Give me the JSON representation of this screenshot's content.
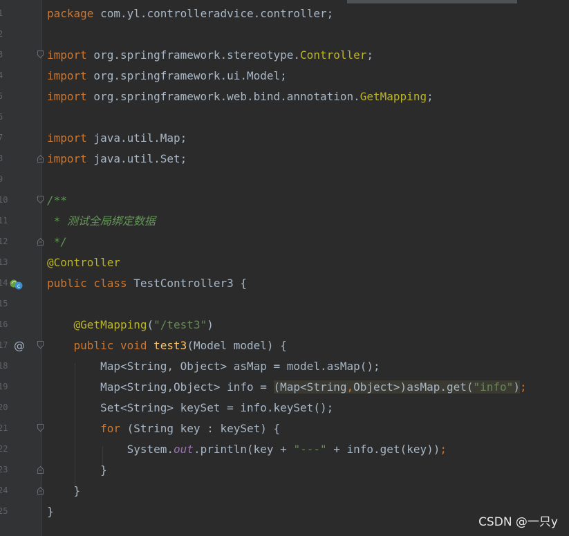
{
  "editor": {
    "lines": [
      {
        "n": "1",
        "html": "<span class=\"kw\">package</span> com.yl.controlleradvice.controller;"
      },
      {
        "n": "2",
        "html": ""
      },
      {
        "n": "3",
        "html": "<span class=\"kw\">import</span> org.springframework.stereotype.<span class=\"ann\">Controller</span>;",
        "fold": "open"
      },
      {
        "n": "4",
        "html": "<span class=\"kw\">import</span> org.springframework.ui.Model;"
      },
      {
        "n": "5",
        "html": "<span class=\"kw\">import</span> org.springframework.web.bind.annotation.<span class=\"ann\">GetMapping</span>;"
      },
      {
        "n": "6",
        "html": ""
      },
      {
        "n": "7",
        "html": "<span class=\"kw\">import</span> java.util.Map;"
      },
      {
        "n": "8",
        "html": "<span class=\"kw\">import</span> java.util.Set;",
        "fold": "close"
      },
      {
        "n": "9",
        "html": ""
      },
      {
        "n": "10",
        "html": "<span class=\"cmt\">/**</span>",
        "fold": "open"
      },
      {
        "n": "11",
        "html": "<span class=\"cmt\"> * 测试全局绑定数据</span>"
      },
      {
        "n": "12",
        "html": "<span class=\"cmt\"> */</span>",
        "fold": "close"
      },
      {
        "n": "13",
        "html": "<span class=\"ann\">@Controller</span>"
      },
      {
        "n": "14",
        "html": "<span class=\"kw\">public class</span> TestController3 {",
        "gutter_icon": "class-icon"
      },
      {
        "n": "15",
        "html": ""
      },
      {
        "n": "16",
        "html": "    <span class=\"ann\">@GetMapping</span>(<span class=\"str\">\"/test3\"</span>)"
      },
      {
        "n": "17",
        "html": "    <span class=\"kw\">public void</span> <span class=\"fn\">test3</span>(Model model) {",
        "gutter_icon": "at-icon",
        "fold": "open"
      },
      {
        "n": "18",
        "html": "        Map&lt;String, Object&gt; asMap = model.asMap();"
      },
      {
        "n": "19",
        "html": "        Map&lt;String,Object&gt; info = <span class=\"hl\">(Map&lt;String<span class=\"kw\">,</span>Object&gt;)asMap.get(<span class=\"str\">\"info\"</span>)</span><span class=\"kw\">;</span>"
      },
      {
        "n": "20",
        "html": "        Set&lt;String&gt; keySet = info.keySet();"
      },
      {
        "n": "21",
        "html": "        <span class=\"kw\">for</span> (String key : keySet) {",
        "fold": "open"
      },
      {
        "n": "22",
        "html": "            System.<span class=\"stat\">out</span>.println(key + <span class=\"str\">\"---\"</span> + info.get(key))<span class=\"kw\">;</span>"
      },
      {
        "n": "23",
        "html": "        }",
        "fold": "close"
      },
      {
        "n": "24",
        "html": "    }",
        "fold": "close"
      },
      {
        "n": "25",
        "html": "}"
      }
    ]
  },
  "watermark": "CSDN @一只y"
}
